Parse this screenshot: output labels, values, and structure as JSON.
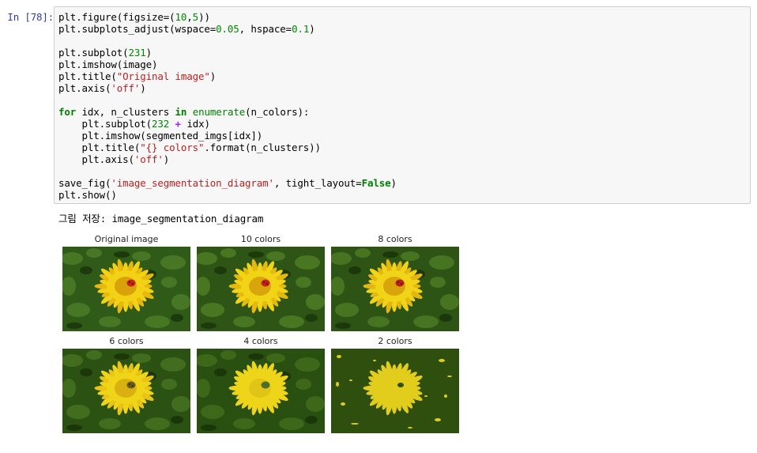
{
  "cell": {
    "prompt": "In [78]:",
    "code_lines": [
      [
        {
          "t": "plt.figure(figsize=(",
          "c": ""
        },
        {
          "t": "10",
          "c": "num"
        },
        {
          "t": ",",
          "c": ""
        },
        {
          "t": "5",
          "c": "num"
        },
        {
          "t": "))",
          "c": ""
        }
      ],
      [
        {
          "t": "plt.subplots_adjust(wspace=",
          "c": ""
        },
        {
          "t": "0.05",
          "c": "num"
        },
        {
          "t": ", hspace=",
          "c": ""
        },
        {
          "t": "0.1",
          "c": "num"
        },
        {
          "t": ")",
          "c": ""
        }
      ],
      [],
      [
        {
          "t": "plt.subplot(",
          "c": ""
        },
        {
          "t": "231",
          "c": "num"
        },
        {
          "t": ")",
          "c": ""
        }
      ],
      [
        {
          "t": "plt.imshow(image)",
          "c": ""
        }
      ],
      [
        {
          "t": "plt.title(",
          "c": ""
        },
        {
          "t": "\"Original image\"",
          "c": "str"
        },
        {
          "t": ")",
          "c": ""
        }
      ],
      [
        {
          "t": "plt.axis(",
          "c": ""
        },
        {
          "t": "'off'",
          "c": "str"
        },
        {
          "t": ")",
          "c": ""
        }
      ],
      [],
      [
        {
          "t": "for",
          "c": "kw"
        },
        {
          "t": " idx, n_clusters ",
          "c": ""
        },
        {
          "t": "in",
          "c": "kw"
        },
        {
          "t": " ",
          "c": ""
        },
        {
          "t": "enumerate",
          "c": "bi"
        },
        {
          "t": "(n_colors):",
          "c": ""
        }
      ],
      [
        {
          "t": "    plt.subplot(",
          "c": ""
        },
        {
          "t": "232",
          "c": "num"
        },
        {
          "t": " ",
          "c": ""
        },
        {
          "t": "+",
          "c": "op"
        },
        {
          "t": " idx)",
          "c": ""
        }
      ],
      [
        {
          "t": "    plt.imshow(segmented_imgs[idx])",
          "c": ""
        }
      ],
      [
        {
          "t": "    plt.title(",
          "c": ""
        },
        {
          "t": "\"{} colors\"",
          "c": "str"
        },
        {
          "t": ".format(n_clusters))",
          "c": ""
        }
      ],
      [
        {
          "t": "    plt.axis(",
          "c": ""
        },
        {
          "t": "'off'",
          "c": "str"
        },
        {
          "t": ")",
          "c": ""
        }
      ],
      [],
      [
        {
          "t": "save_fig(",
          "c": ""
        },
        {
          "t": "'image_segmentation_diagram'",
          "c": "str"
        },
        {
          "t": ", tight_layout=",
          "c": ""
        },
        {
          "t": "False",
          "c": "kw"
        },
        {
          "t": ")",
          "c": ""
        }
      ],
      [
        {
          "t": "plt.show()",
          "c": ""
        }
      ]
    ]
  },
  "output": {
    "text": "그림 저장: image_segmentation_diagram",
    "panels": [
      {
        "title": "Original image",
        "style": "original"
      },
      {
        "title": "10 colors",
        "style": "q10"
      },
      {
        "title": "8 colors",
        "style": "q8"
      },
      {
        "title": "6 colors",
        "style": "q6"
      },
      {
        "title": "4 colors",
        "style": "q4"
      },
      {
        "title": "2 colors",
        "style": "q2"
      }
    ]
  },
  "colors": {
    "prompt": "#303f9f",
    "keyword": "#008000",
    "number": "#008800",
    "string": "#ba2121",
    "operator": "#aa22ff"
  }
}
